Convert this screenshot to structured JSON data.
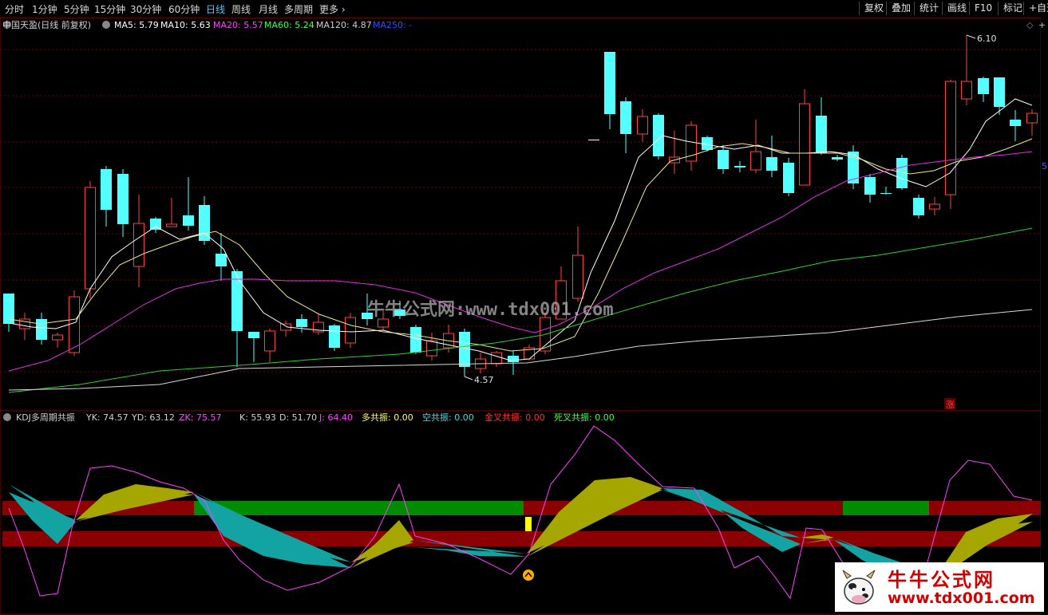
{
  "toolbar": {
    "periods": [
      "分时",
      "1分钟",
      "5分钟",
      "15分钟",
      "30分钟",
      "60分钟",
      "日线",
      "周线",
      "月线",
      "多周期",
      "更多"
    ],
    "active": "日线",
    "right_buttons": [
      "复权",
      "叠加",
      "统计",
      "画线",
      "F10",
      "标记",
      "+自选"
    ]
  },
  "main_chart": {
    "stock_name": "中国天盈(日线 前复权)",
    "ma_items": [
      {
        "label": "MA5: 5.79",
        "color": "#ffffff"
      },
      {
        "label": "MA10: 5.63",
        "color": "#ffffff"
      },
      {
        "label": "MA20: 5.57",
        "color": "#ff44ff"
      },
      {
        "label": "MA60: 5.24",
        "color": "#44ff44"
      },
      {
        "label": "MA120: 4.87",
        "color": "#d0d0d0"
      },
      {
        "label": "MA250: -",
        "color": "#3050ff"
      }
    ],
    "high_label": "6.10",
    "low_label": "4.57",
    "right_edge_label": "5",
    "marker_char": "涨",
    "colors": {
      "up": "#ff4040",
      "down": "#54ffff",
      "grid": "#800000"
    }
  },
  "indicator": {
    "title": "KDJ多周期共振",
    "values": [
      {
        "label": "YK: 74.57",
        "color": "#d0d0d0"
      },
      {
        "label": "YD: 63.12",
        "color": "#d0d0d0"
      },
      {
        "label": "ZK: 75.57",
        "color": "#ff44ff"
      },
      {
        "label": "K: 55.93",
        "color": "#d0d0d0"
      },
      {
        "label": "D: 51.70",
        "color": "#d0d0d0"
      },
      {
        "label": "J: 64.40",
        "color": "#ff44ff"
      },
      {
        "label": "多共振: 0.00",
        "color": "#ffff60"
      },
      {
        "label": "空共振: 0.00",
        "color": "#44dddd"
      },
      {
        "label": "金叉共振: 0.00",
        "color": "#ff3030"
      },
      {
        "label": "死叉共振: 0.00",
        "color": "#44ff44"
      }
    ]
  },
  "watermark": "牛牛公式网:www.tdx001.com",
  "logo": {
    "title": "牛牛公式网",
    "url": "www.tdx001.com"
  }
}
